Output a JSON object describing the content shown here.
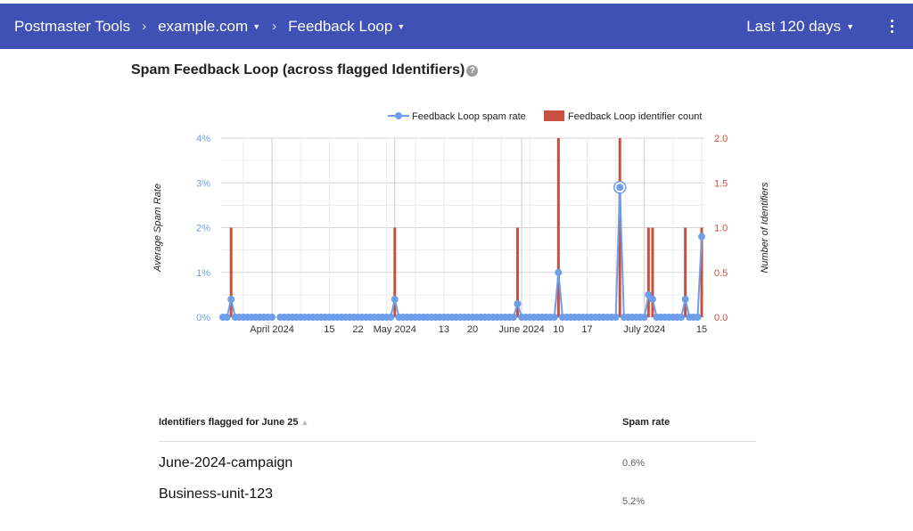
{
  "header": {
    "crumbs": [
      {
        "label": "Postmaster Tools",
        "dropdown": false
      },
      {
        "label": "example.com",
        "dropdown": true
      },
      {
        "label": "Feedback Loop",
        "dropdown": true
      }
    ],
    "separator": "›",
    "date_range": "Last 120 days",
    "menu_icon": "more-vert-icon"
  },
  "page": {
    "title": "Spam Feedback Loop (across flagged Identifiers)",
    "help_icon": "?"
  },
  "colors": {
    "header_bg": "#3f51b5",
    "spam_rate": "#6d9eeb",
    "identifier_count": "#c9503d"
  },
  "chart_data": {
    "type": "line",
    "title": "Spam Feedback Loop (across flagged Identifiers)",
    "legend": [
      {
        "name": "Feedback Loop spam rate",
        "kind": "line"
      },
      {
        "name": "Feedback Loop identifier count",
        "kind": "bar"
      }
    ],
    "legend_position": "top-right",
    "ylabel_left": "Average Spam Rate",
    "ylabel_right": "Number of Identifiers",
    "ylim_left": [
      0,
      4
    ],
    "ylim_right": [
      0,
      2
    ],
    "yticks_left": [
      "0%",
      "1%",
      "2%",
      "3%",
      "4%"
    ],
    "yticks_right": [
      "0.0",
      "0.5",
      "1.0",
      "1.5",
      "2.0"
    ],
    "x_start": "2024-03-20",
    "x_end": "2024-07-15",
    "xticks": [
      {
        "date": "2024-04-01",
        "label": "April 2024",
        "major": true
      },
      {
        "date": "2024-04-15",
        "label": "15"
      },
      {
        "date": "2024-04-22",
        "label": "22"
      },
      {
        "date": "2024-05-01",
        "label": "May 2024",
        "major": true
      },
      {
        "date": "2024-05-13",
        "label": "13"
      },
      {
        "date": "2024-05-20",
        "label": "20"
      },
      {
        "date": "2024-06-01",
        "label": "June 2024",
        "major": true
      },
      {
        "date": "2024-06-10",
        "label": "10"
      },
      {
        "date": "2024-06-17",
        "label": "17"
      },
      {
        "date": "2024-07-01",
        "label": "July 2024",
        "major": true
      },
      {
        "date": "2024-07-15",
        "label": "15"
      }
    ],
    "minor_gridlines": [
      "2024-03-25",
      "2024-04-08",
      "2024-04-15",
      "2024-04-22",
      "2024-04-29",
      "2024-05-06",
      "2024-05-13",
      "2024-05-20",
      "2024-05-27",
      "2024-06-03",
      "2024-06-10",
      "2024-06-17",
      "2024-06-24",
      "2024-07-08",
      "2024-07-15"
    ],
    "missing_dates": [
      "2024-04-02"
    ],
    "series": [
      {
        "name": "Feedback Loop spam rate",
        "unit": "%",
        "default": 0,
        "nonzero": [
          {
            "date": "2024-03-22",
            "value": 0.4
          },
          {
            "date": "2024-05-01",
            "value": 0.4
          },
          {
            "date": "2024-05-31",
            "value": 0.3
          },
          {
            "date": "2024-06-10",
            "value": 1.0
          },
          {
            "date": "2024-06-25",
            "value": 2.9,
            "selected": true
          },
          {
            "date": "2024-07-02",
            "value": 0.5
          },
          {
            "date": "2024-07-03",
            "value": 0.4
          },
          {
            "date": "2024-07-11",
            "value": 0.4
          },
          {
            "date": "2024-07-15",
            "value": 1.8
          }
        ]
      },
      {
        "name": "Feedback Loop identifier count",
        "default": 0,
        "nonzero": [
          {
            "date": "2024-03-22",
            "value": 1
          },
          {
            "date": "2024-05-01",
            "value": 1
          },
          {
            "date": "2024-05-31",
            "value": 1
          },
          {
            "date": "2024-06-10",
            "value": 2
          },
          {
            "date": "2024-06-25",
            "value": 2
          },
          {
            "date": "2024-07-02",
            "value": 1
          },
          {
            "date": "2024-07-03",
            "value": 1
          },
          {
            "date": "2024-07-11",
            "value": 1
          },
          {
            "date": "2024-07-15",
            "value": 1
          }
        ]
      }
    ]
  },
  "table": {
    "columns": [
      {
        "label": "Identifiers flagged for June 25",
        "sort": "ascending"
      },
      {
        "label": "Spam rate"
      }
    ],
    "rows": [
      {
        "identifier": "June-2024-campaign",
        "spam_rate": "0.6%"
      },
      {
        "identifier": "Business-unit-123",
        "spam_rate": "5.2%"
      }
    ]
  }
}
